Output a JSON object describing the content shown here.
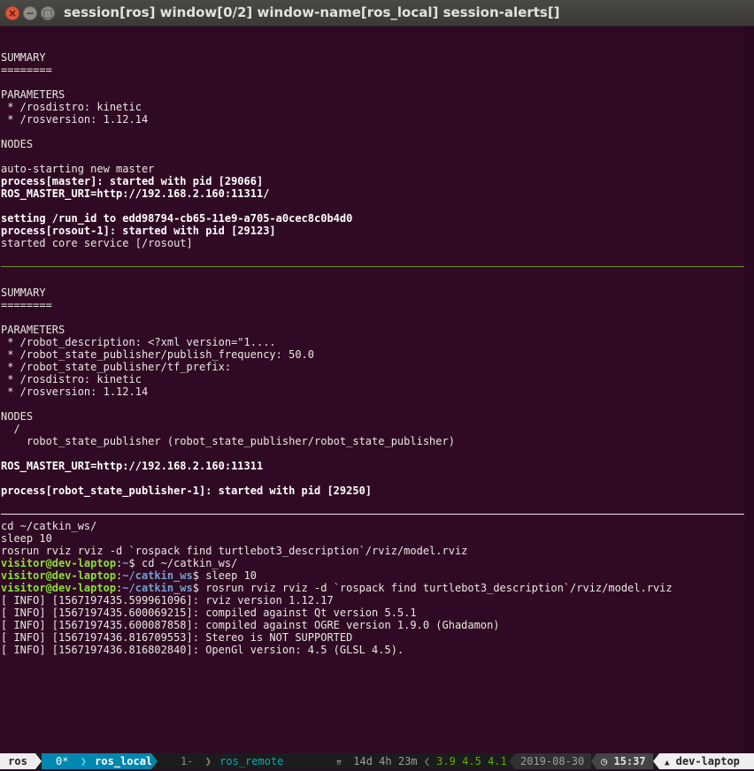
{
  "window": {
    "title": "session[ros] window[0/2] window-name[ros_local] session-alerts[]",
    "close_icon": "×",
    "minimize_icon": "−",
    "maximize_icon": "□"
  },
  "pane1": {
    "lines": [
      {
        "text": "",
        "bold": false
      },
      {
        "text": "",
        "bold": false
      },
      {
        "text": "SUMMARY",
        "bold": false
      },
      {
        "text": "========",
        "bold": false
      },
      {
        "text": "",
        "bold": false
      },
      {
        "text": "PARAMETERS",
        "bold": false
      },
      {
        "text": " * /rosdistro: kinetic",
        "bold": false
      },
      {
        "text": " * /rosversion: 1.12.14",
        "bold": false
      },
      {
        "text": "",
        "bold": false
      },
      {
        "text": "NODES",
        "bold": false
      },
      {
        "text": "",
        "bold": false
      },
      {
        "text": "auto-starting new master",
        "bold": false
      },
      {
        "text": "process[master]: started with pid [29066]",
        "bold": true
      },
      {
        "text": "ROS_MASTER_URI=http://192.168.2.160:11311/",
        "bold": true
      },
      {
        "text": "",
        "bold": false
      },
      {
        "text": "setting /run_id to edd98794-cb65-11e9-a705-a0cec8c0b4d0",
        "bold": true
      },
      {
        "text": "process[rosout-1]: started with pid [29123]",
        "bold": true
      },
      {
        "text": "started core service [/rosout]",
        "bold": false
      }
    ]
  },
  "pane2": {
    "lines": [
      {
        "text": "",
        "bold": false
      },
      {
        "text": "SUMMARY",
        "bold": false
      },
      {
        "text": "========",
        "bold": false
      },
      {
        "text": "",
        "bold": false
      },
      {
        "text": "PARAMETERS",
        "bold": false
      },
      {
        "text": " * /robot_description: <?xml version=\"1....",
        "bold": false
      },
      {
        "text": " * /robot_state_publisher/publish_frequency: 50.0",
        "bold": false
      },
      {
        "text": " * /robot_state_publisher/tf_prefix:",
        "bold": false
      },
      {
        "text": " * /rosdistro: kinetic",
        "bold": false
      },
      {
        "text": " * /rosversion: 1.12.14",
        "bold": false
      },
      {
        "text": "",
        "bold": false
      },
      {
        "text": "NODES",
        "bold": false
      },
      {
        "text": "  /",
        "bold": false
      },
      {
        "text": "    robot_state_publisher (robot_state_publisher/robot_state_publisher)",
        "bold": false
      },
      {
        "text": "",
        "bold": false
      },
      {
        "text": "ROS_MASTER_URI=http://192.168.2.160:11311",
        "bold": true
      },
      {
        "text": "",
        "bold": false
      },
      {
        "text": "process[robot_state_publisher-1]: started with pid [29250]",
        "bold": true
      }
    ]
  },
  "pane3": {
    "lines": [
      {
        "text": "cd ~/catkin_ws/"
      },
      {
        "text": "sleep 10"
      },
      {
        "text": "rosrun rviz rviz -d `rospack find turtlebot3_description`/rviz/model.rviz"
      },
      {
        "user": "visitor@dev-laptop",
        "path": "~",
        "cmd": "$ cd ~/catkin_ws/"
      },
      {
        "user": "visitor@dev-laptop",
        "path": "~/catkin_ws",
        "cmd": "$ sleep 10"
      },
      {
        "user": "visitor@dev-laptop",
        "path": "~/catkin_ws",
        "cmd": "$ rosrun rviz rviz -d `rospack find turtlebot3_description`/rviz/model.rviz"
      },
      {
        "text": "[ INFO] [1567197435.599961096]: rviz version 1.12.17"
      },
      {
        "text": "[ INFO] [1567197435.600069215]: compiled against Qt version 5.5.1"
      },
      {
        "text": "[ INFO] [1567197435.600087858]: compiled against OGRE version 1.9.0 (Ghadamon)"
      },
      {
        "text": "[ INFO] [1567197436.816709553]: Stereo is NOT SUPPORTED"
      },
      {
        "text": "[ INFO] [1567197436.816802840]: OpenGl version: 4.5 (GLSL 4.5)."
      }
    ]
  },
  "statusbar": {
    "session": "ros",
    "win0_index": "0*",
    "win0_arrow": "❯",
    "win0_name": "ros_local",
    "win1_index": "1-",
    "win1_arrow": "❯",
    "win1_name": "ros_remote",
    "uptime_icon": "⇈",
    "uptime": "14d 4h 23m",
    "load_sep": "❮",
    "load1": "3.9",
    "load5": "4.5",
    "load15": "4.1",
    "date_sep": "❮",
    "date": "2019-08-30",
    "time_sep": "❮",
    "clock_icon": "◷",
    "time": "15:37",
    "host_icon": "▲",
    "hostname": "dev-laptop",
    "colors": {
      "session_bg": "#eeeeee",
      "active_window_bg": "#0087af",
      "active_window_fg": "#ffffff",
      "inactive_window_fg": "#00afaf",
      "load_fg": "#5faf00",
      "date_bg": "#303030",
      "time_bg": "#444444",
      "host_bg": "#eeeeee"
    }
  }
}
